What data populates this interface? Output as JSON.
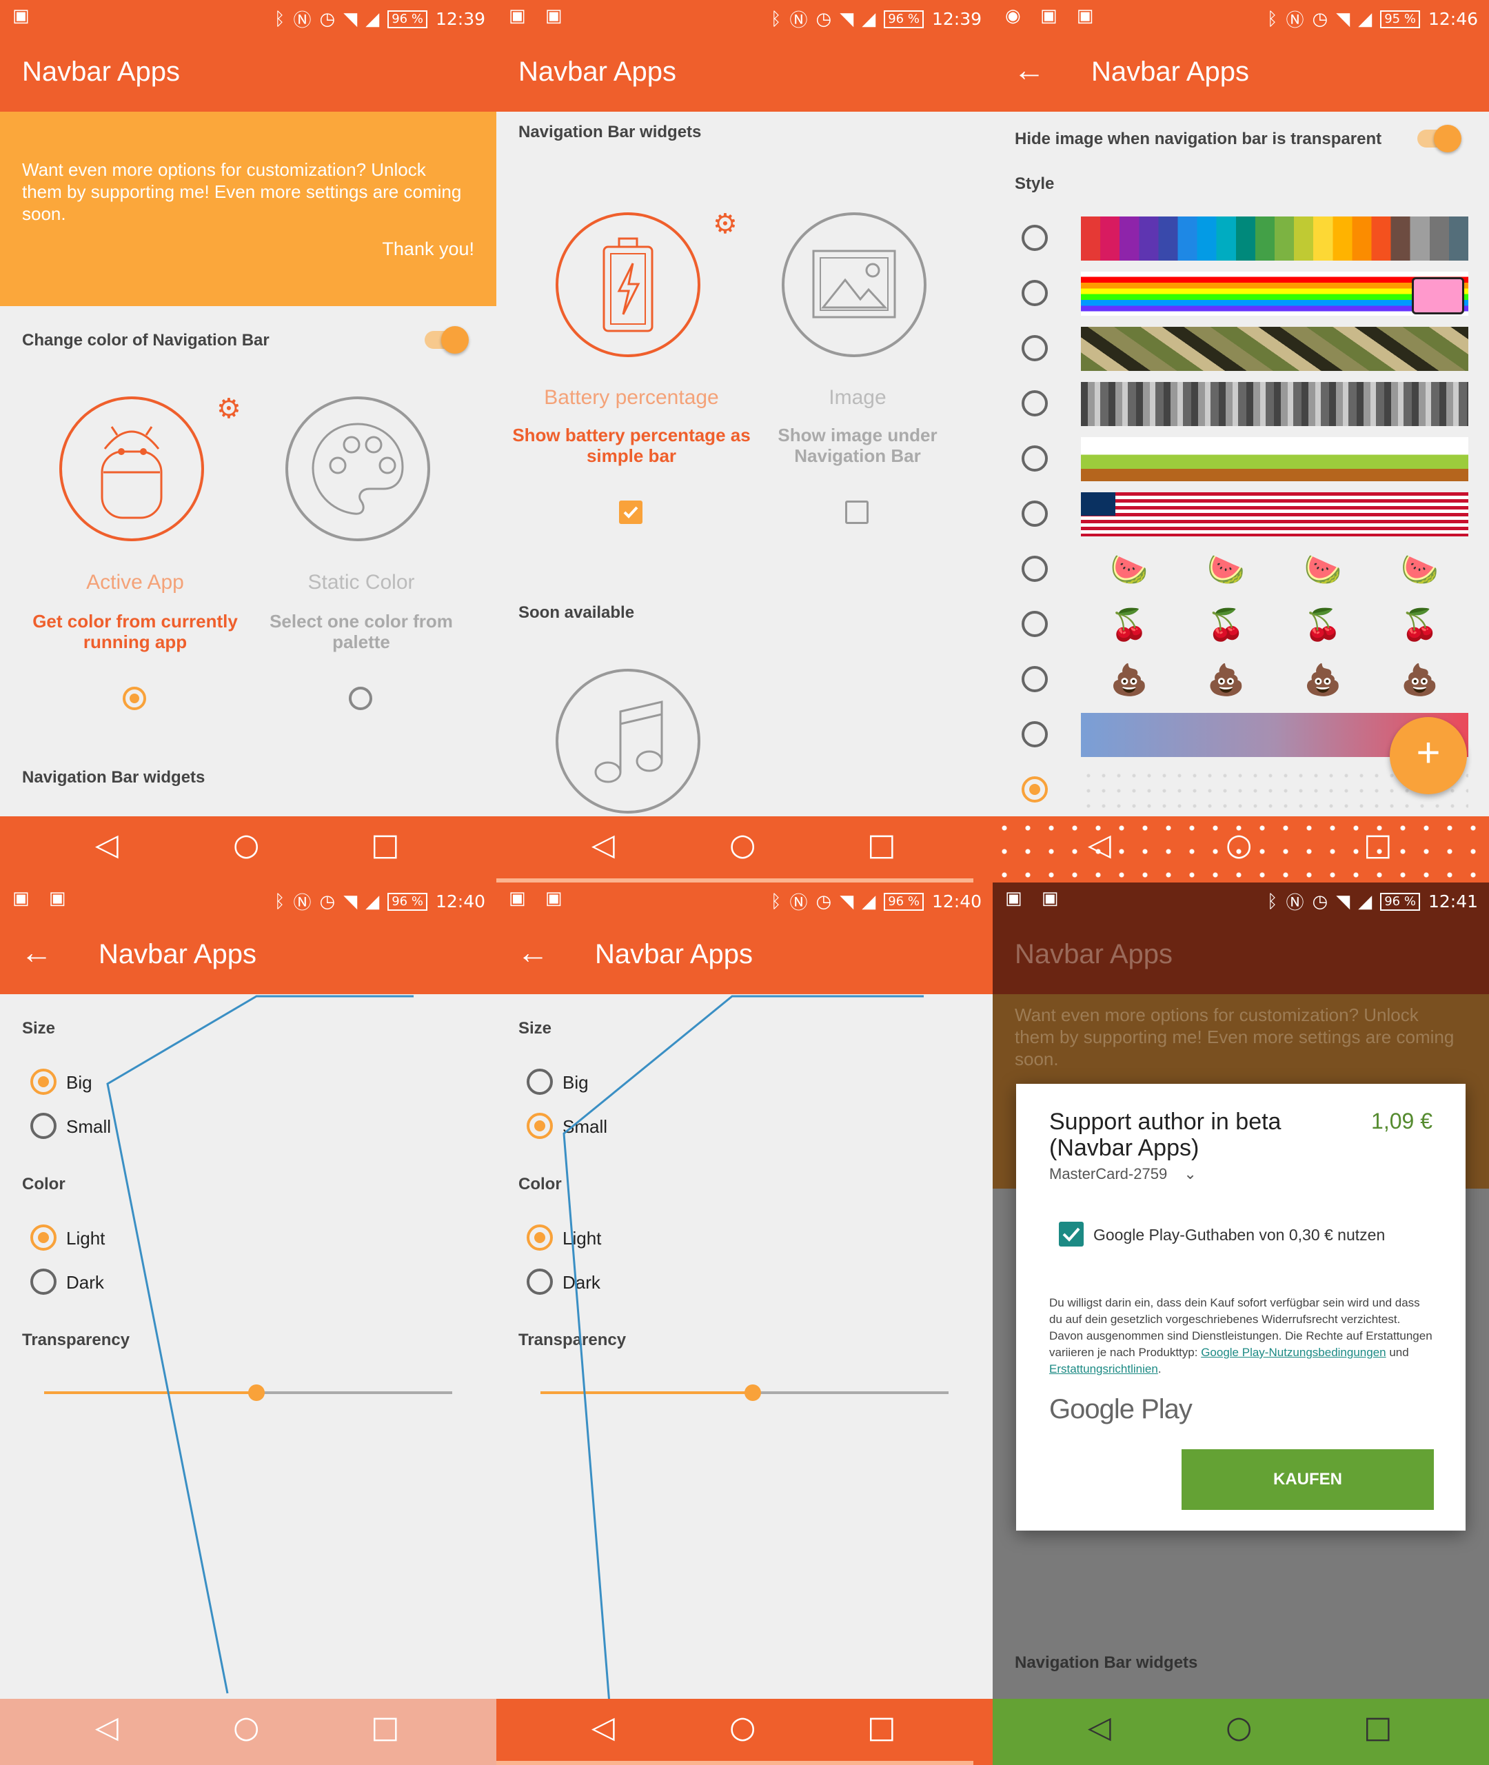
{
  "app": {
    "title": "Navbar Apps"
  },
  "colors": {
    "primary": "#ef5f2c",
    "accent": "#f9a23a",
    "banner": "#fba73b",
    "green": "#64a234"
  },
  "status": {
    "p1": {
      "battery": "96 %",
      "time": "12:39"
    },
    "p2": {
      "battery": "96 %",
      "time": "12:39"
    },
    "p3": {
      "battery": "95 %",
      "time": "12:46"
    },
    "p4": {
      "battery": "96 %",
      "time": "12:40"
    },
    "p5": {
      "battery": "96 %",
      "time": "12:40"
    },
    "p6": {
      "battery": "96 %",
      "time": "12:41"
    }
  },
  "panel1": {
    "banner_text": "Want even more options for customization? Unlock them by supporting me! Even more settings are coming soon.",
    "banner_thanks": "Thank you!",
    "change_color_label": "Change color of Navigation Bar",
    "active_app_title": "Active App",
    "active_app_desc": "Get color from currently running app",
    "static_color_title": "Static Color",
    "static_color_desc": "Select one color from palette",
    "widgets_header": "Navigation Bar widgets"
  },
  "panel2": {
    "widgets_header": "Navigation Bar widgets",
    "battery_title": "Battery percentage",
    "battery_desc": "Show battery percentage as simple bar",
    "image_title": "Image",
    "image_desc": "Show image under Navigation Bar",
    "soon_header": "Soon available"
  },
  "panel3": {
    "hide_image_label": "Hide image when navigation bar is transparent",
    "style_header": "Style",
    "fab_label": "+",
    "fruit": {
      "watermelon": "🍉",
      "cherry": "🍒",
      "poop": "💩"
    }
  },
  "size_color_panel": {
    "size_header": "Size",
    "size_big": "Big",
    "size_small": "Small",
    "color_header": "Color",
    "color_light": "Light",
    "color_dark": "Dark",
    "transparency_header": "Transparency",
    "transparency_p4": 0.52,
    "transparency_p5": 0.52
  },
  "panel6": {
    "banner_text": "Want even more options for customization? Unlock them by supporting me! Even more settings are coming soon.",
    "dialog_title": "Support author in beta (Navbar Apps)",
    "price": "1,09 €",
    "payment_method": "MasterCard-2759",
    "credit_label": "Google Play-Guthaben von 0,30 € nutzen",
    "legal_text": "Du willigst darin ein, dass dein Kauf sofort verfügbar sein wird und dass du auf dein gesetzlich vorgeschriebenes Widerrufsrecht verzichtest. Davon ausgenommen sind Dienstleistungen. Die Rechte auf Erstattungen variieren je nach Produkttyp:",
    "legal_link1": "Google Play-Nutzungsbedingungen",
    "legal_and": "und",
    "legal_link2": "Erstattungsrichtlinien",
    "google_play": "Google Play",
    "buy_button": "KAUFEN",
    "widgets_header": "Navigation Bar widgets"
  },
  "icons": {
    "back": "◁",
    "home": "○",
    "recent": "□",
    "arrow_back": "←",
    "gear": "⚙",
    "bluetooth": "ᛒ",
    "alarm": "⏰",
    "wifi": "◥",
    "chevron": "⌄"
  }
}
